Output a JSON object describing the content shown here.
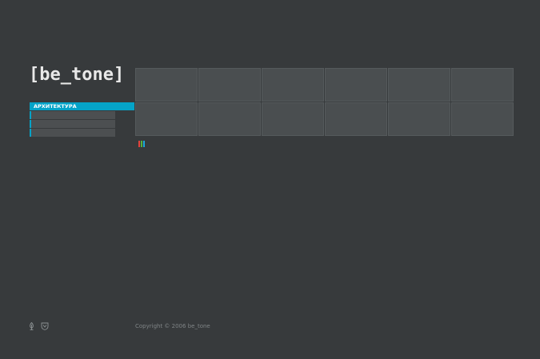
{
  "logo": {
    "text": "[be_tone]"
  },
  "menu": {
    "active_label": "АРХИТЕКТУРА",
    "items": [
      "",
      "",
      ""
    ]
  },
  "gallery": {
    "tile_count": 12
  },
  "color_bars": [
    "#e4433b",
    "#56b23a",
    "#1aa7de"
  ],
  "footer": {
    "copyright": "Copyright © 2006 be_tone",
    "icons": [
      "leaf-icon",
      "shield-icon"
    ]
  },
  "colors": {
    "background": "#373a3c",
    "accent": "#05a3c8",
    "tile": "#4a4e50"
  }
}
